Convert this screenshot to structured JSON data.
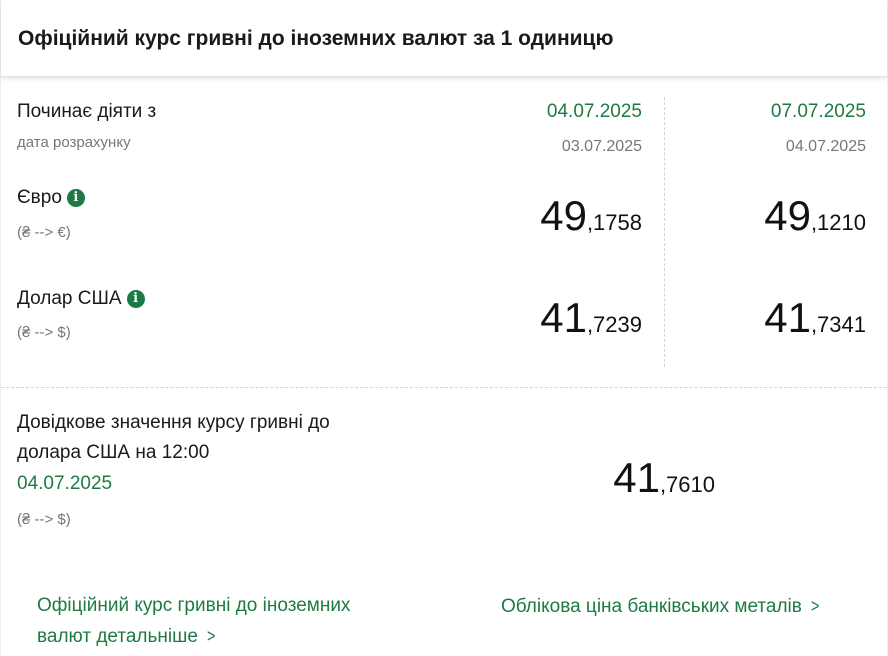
{
  "header": {
    "title": "Офіційний курс гривні до іноземних валют за 1 одиницю"
  },
  "table": {
    "effective_label": "Починає діяти з",
    "calc_label": "дата розрахунку",
    "columns": [
      {
        "effective_date": "04.07.2025",
        "calc_date": "03.07.2025"
      },
      {
        "effective_date": "07.07.2025",
        "calc_date": "04.07.2025"
      }
    ],
    "rows": [
      {
        "name": "Євро",
        "conversion": "(₴ --> €)",
        "icon": "info-icon",
        "rates": [
          {
            "int": "49",
            "frac": ",1758"
          },
          {
            "int": "49",
            "frac": ",1210"
          }
        ]
      },
      {
        "name": "Долар США",
        "conversion": "(₴ --> $)",
        "icon": "info-icon",
        "rates": [
          {
            "int": "41",
            "frac": ",7239"
          },
          {
            "int": "41",
            "frac": ",7341"
          }
        ]
      }
    ]
  },
  "reference": {
    "line1": "Довідкове значення курсу гривні до",
    "line2": "долара США на 12:00",
    "date": "04.07.2025",
    "conversion": "(₴ --> $)",
    "rate_int": "41",
    "rate_frac": ",7610"
  },
  "links": {
    "official_line1": "Офіційний курс гривні до іноземних",
    "official_line2": "валют детальніше",
    "metals": "Облікова ціна банківських металів",
    "chevron_icon": "chevron-right-icon"
  },
  "colors": {
    "accent": "#1e7a45",
    "muted": "#777777"
  }
}
